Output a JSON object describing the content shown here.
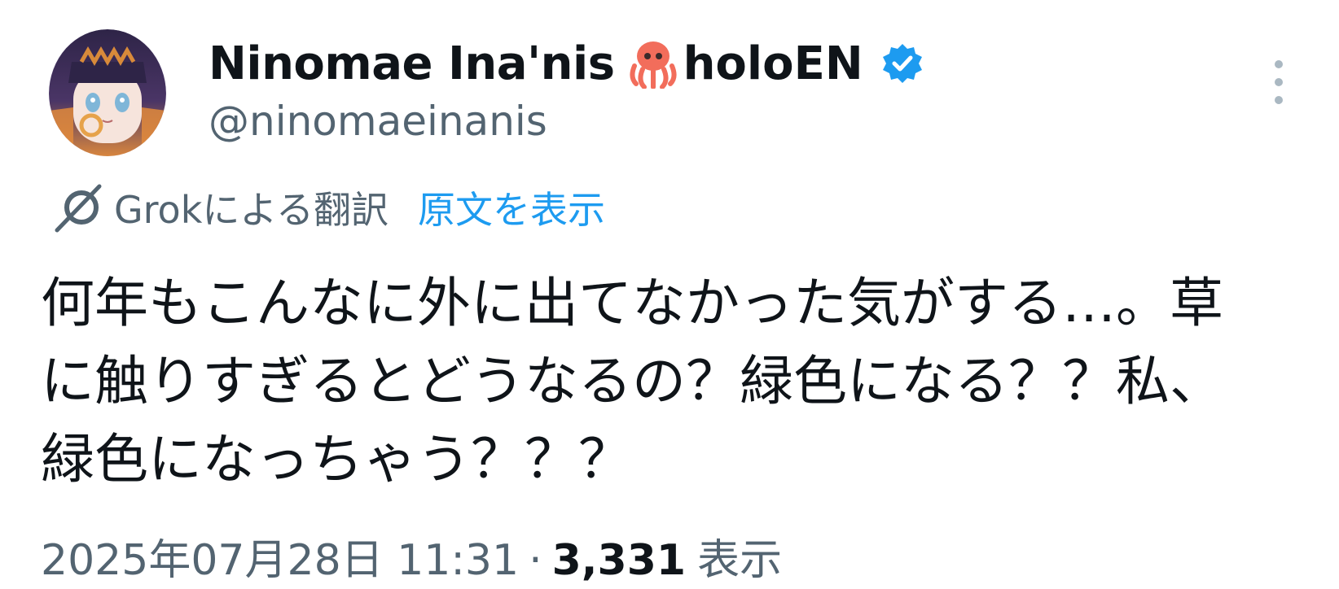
{
  "author": {
    "display_name": "Ninomae Ina'nis",
    "emoji_icon": "octopus-emoji",
    "name_suffix": "holoEN",
    "verified": true,
    "handle": "@ninomaeinanis"
  },
  "translation": {
    "icon": "grok-icon",
    "label": "Grokによる翻訳",
    "show_original": "原文を表示"
  },
  "tweet": {
    "text": "何年もこんなに外に出てなかった気がする…。草に触りすぎるとどうなるの？緑色になる？？私、緑色になっちゃう？？？"
  },
  "meta": {
    "timestamp": "2025年07月28日 11:31",
    "separator": "·",
    "views_count": "3,331",
    "views_label": "表示"
  },
  "colors": {
    "accent": "#1d9bf0",
    "secondary_text": "#536471",
    "primary_text": "#0f1419"
  }
}
